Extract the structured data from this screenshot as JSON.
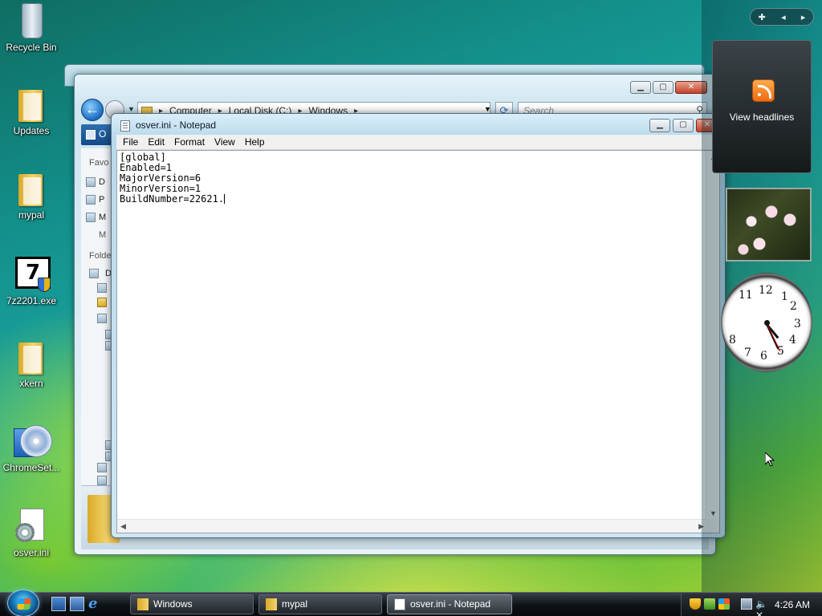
{
  "desktop": {
    "icons": [
      {
        "label": "Recycle Bin"
      },
      {
        "label": "Updates"
      },
      {
        "label": "mypal"
      },
      {
        "label": "7z2201.exe"
      },
      {
        "label": "xkern"
      },
      {
        "label": "ChromeSet..."
      },
      {
        "label": "osver.ini"
      }
    ]
  },
  "explorer": {
    "address": {
      "crumbs": [
        "Computer",
        "Local Disk (C:)",
        "Windows"
      ]
    },
    "search_placeholder": "Search",
    "organize_label": "O",
    "nav_fragments": [
      "Favo",
      "D",
      "P",
      "M",
      "M",
      "Folde",
      "D"
    ]
  },
  "notepad": {
    "title": "osver.ini - Notepad",
    "menu": [
      "File",
      "Edit",
      "Format",
      "View",
      "Help"
    ],
    "content_lines": [
      "[global]",
      "Enabled=1",
      "MajorVersion=6",
      "MinorVersion=1",
      "BuildNumber=22621."
    ]
  },
  "gadgets": {
    "feed_label": "View headlines",
    "clock_numbers": [
      "12",
      "1",
      "2",
      "3",
      "4",
      "5",
      "6",
      "7",
      "8",
      "11"
    ]
  },
  "taskbar": {
    "tasks": [
      {
        "label": "Windows",
        "icon": "folder-icon",
        "active": false
      },
      {
        "label": "mypal",
        "icon": "folder-icon",
        "active": false
      },
      {
        "label": "osver.ini - Notepad",
        "icon": "notepad-icon",
        "active": true
      }
    ],
    "clock": "4:26 AM"
  }
}
